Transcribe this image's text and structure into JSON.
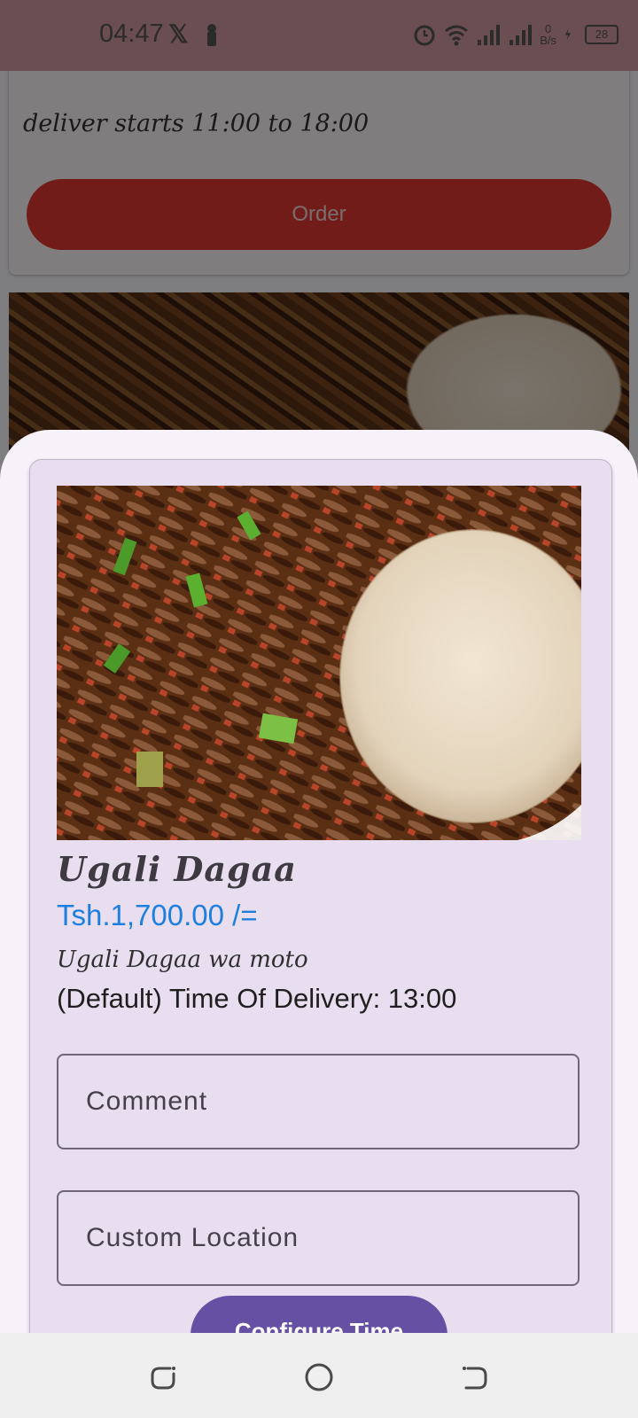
{
  "status_bar": {
    "time": "04:47",
    "net_speed_value": "0",
    "net_speed_unit": "B/s",
    "battery": "28"
  },
  "background_card": {
    "delivery_hint": "deliver starts 11:00 to 18:00",
    "order_label": "Order"
  },
  "product": {
    "title": "Ugali Dagaa",
    "price": "Tsh.1,700.00 /=",
    "description": "Ugali Dagaa wa moto",
    "delivery_time": "(Default) Time Of Delivery: 13:00"
  },
  "form": {
    "comment_placeholder": "Comment",
    "location_placeholder": "Custom Location",
    "configure_label": "Configure Time"
  },
  "colors": {
    "accent": "#6650a4",
    "price": "#1e7fe0",
    "order_button": "#e53935"
  }
}
